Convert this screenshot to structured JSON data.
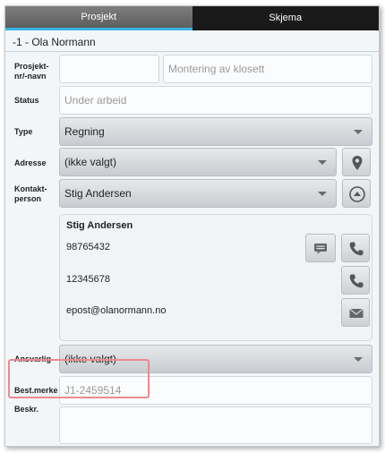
{
  "tabs": [
    {
      "label": "Prosjekt"
    },
    {
      "label": "Skjema"
    }
  ],
  "header": {
    "title": "-1 - Ola Normann"
  },
  "project": {
    "label": "Prosjekt-\nnr/-navn",
    "number_value": "",
    "name_placeholder": "Montering av klosett"
  },
  "status": {
    "label": "Status",
    "placeholder": "Under arbeid"
  },
  "type": {
    "label": "Type",
    "value": "Regning"
  },
  "address": {
    "label": "Adresse",
    "value": "(ikke valgt)",
    "location_icon": "map-pin-icon"
  },
  "contact": {
    "label": "Kontakt-\nperson",
    "value": "Stig Andersen",
    "collapse_icon": "chevron-up-circle-icon",
    "card": {
      "name": "Stig Andersen",
      "mobile": "98765432",
      "phone": "12345678",
      "email": "epost@olanormann.no"
    }
  },
  "responsible": {
    "label": "Ansvarlig",
    "value": "(ikke valgt)"
  },
  "order_ref": {
    "label": "Best.merke",
    "placeholder": "J1-2459514"
  },
  "description": {
    "label": "Beskr.",
    "value": ""
  }
}
